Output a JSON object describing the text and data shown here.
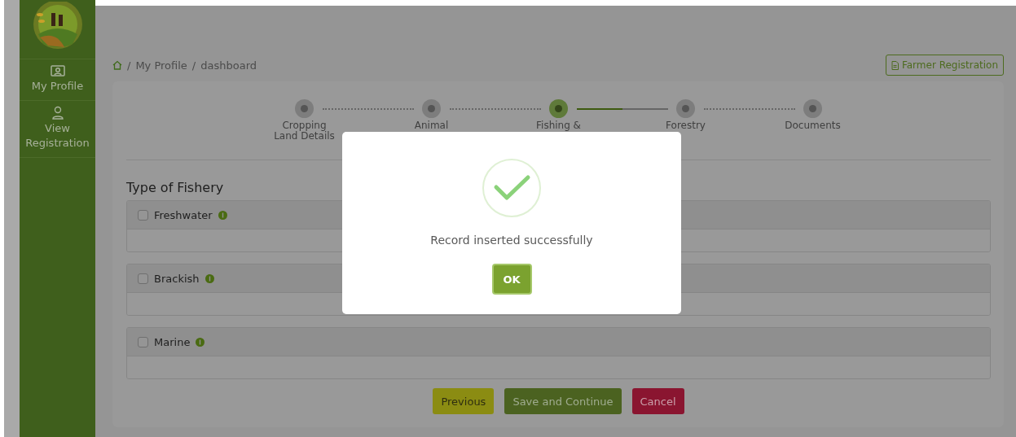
{
  "sidebar": {
    "items": [
      {
        "kind": "profile",
        "label": "My Profile"
      },
      {
        "kind": "user",
        "label": "View Registration"
      }
    ]
  },
  "breadcrumb": {
    "separator": "/",
    "items": [
      "My Profile",
      "dashboard"
    ]
  },
  "header_button": "Farmer Registration",
  "stepper": [
    {
      "label": "Cropping\nLand Details",
      "selected": false
    },
    {
      "label": "Animal",
      "selected": false
    },
    {
      "label": "Fishing &",
      "selected": true
    },
    {
      "label": "Forestry",
      "selected": false
    },
    {
      "label": "Documents",
      "selected": false
    }
  ],
  "section_title": "Type of Fishery",
  "fishery_types": [
    {
      "label": "Freshwater",
      "checked": false
    },
    {
      "label": "Brackish",
      "checked": false
    },
    {
      "label": "Marine",
      "checked": false
    }
  ],
  "actions": [
    {
      "kind": "previous",
      "label": "Previous"
    },
    {
      "kind": "save",
      "label": "Save and Continue"
    },
    {
      "kind": "cancel",
      "label": "Cancel"
    }
  ],
  "dialog": {
    "message": "Record inserted successfully",
    "button": "OK"
  }
}
